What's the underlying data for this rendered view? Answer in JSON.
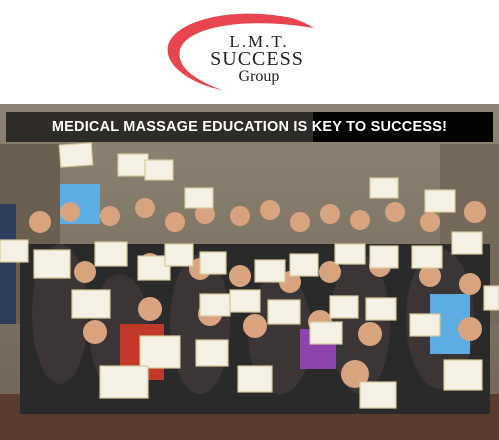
{
  "logo": {
    "line1": "L.M.T.",
    "line2": "SUCCESS",
    "line3": "Group",
    "swoosh_color": "#e8464f"
  },
  "banner": {
    "text": "MEDICAL MASSAGE EDUCATION IS KEY TO SUCCESS!"
  },
  "photo": {
    "description_icon": "group-photo-image"
  },
  "colors": {
    "banner_bg": "#1e1e1e",
    "text": "#ffffff"
  }
}
